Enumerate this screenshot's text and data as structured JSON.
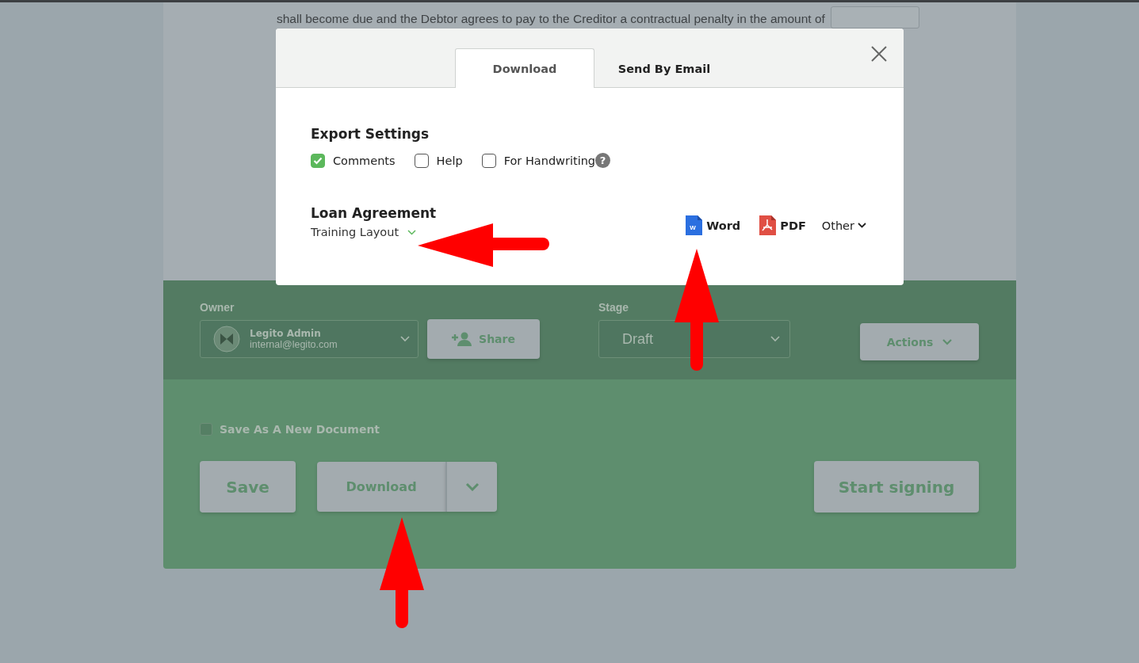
{
  "document": {
    "text": "shall become due and  the Debtor agrees to pay to the Creditor a contractual penalty in the amount of"
  },
  "dialog": {
    "tabs": [
      {
        "label": "Download",
        "selected": true
      },
      {
        "label": "Send By Email",
        "selected": false
      }
    ],
    "section_title": "Export Settings",
    "options": [
      {
        "label": "Comments",
        "checked": true
      },
      {
        "label": "Help",
        "checked": false
      },
      {
        "label": "For Handwriting",
        "checked": false,
        "help_icon": "?"
      }
    ],
    "document_title": "Loan Agreement",
    "layout": "Training Layout",
    "formats": [
      {
        "label": "Word",
        "kind": "word",
        "icon_letter": "W"
      },
      {
        "label": "PDF",
        "kind": "pdf"
      },
      {
        "label": "Other",
        "kind": "menu"
      }
    ]
  },
  "owner": {
    "label": "Owner",
    "name": "Legito Admin",
    "email": "internal@legito.com"
  },
  "share_button": "Share",
  "stage": {
    "label": "Stage",
    "value": "Draft"
  },
  "actions_button": "Actions",
  "save_as_new": {
    "label": "Save As A New Document",
    "checked": false
  },
  "save_button": "Save",
  "download_button": "Download",
  "signing_button": "Start signing"
}
